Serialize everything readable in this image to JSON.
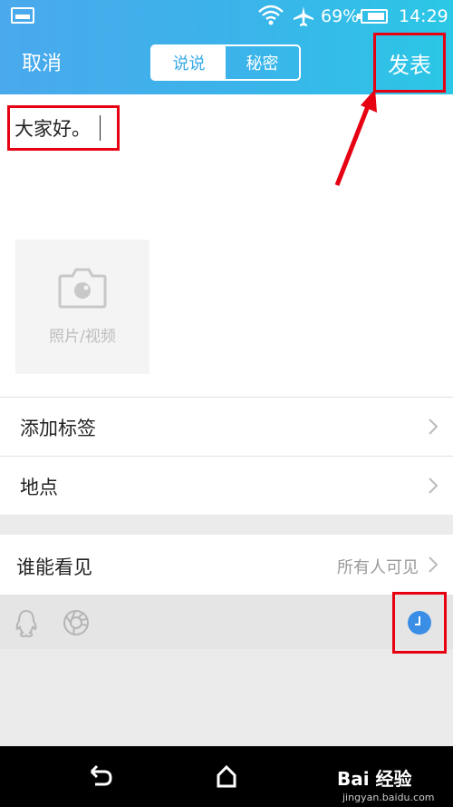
{
  "status_bar": {
    "battery": "69%",
    "time": "14:29",
    "battery_level": 0.69
  },
  "header": {
    "cancel_label": "取消",
    "tabs": [
      {
        "label": "说说",
        "active": true
      },
      {
        "label": "秘密",
        "active": false
      }
    ],
    "publish_label": "发表"
  },
  "editor": {
    "text": "大家好。"
  },
  "media": {
    "label": "照片/视频"
  },
  "rows": [
    {
      "label": "添加标签"
    },
    {
      "label": "地点"
    }
  ],
  "visibility": {
    "label": "谁能看见",
    "value": "所有人可见"
  },
  "watermark": {
    "brand": "Bai 经验",
    "url": "jingyan.baidu.com"
  },
  "colors": {
    "header_start": "#4aa9ec",
    "header_end": "#2bc7e6",
    "highlight": "#e60012",
    "clock": "#3b8ee6"
  },
  "icons": [
    "wifi-icon",
    "airplane-icon",
    "battery-icon",
    "camera-icon",
    "chevron-right-icon",
    "qq-icon",
    "lens-icon",
    "clock-icon",
    "back-icon",
    "home-icon"
  ]
}
